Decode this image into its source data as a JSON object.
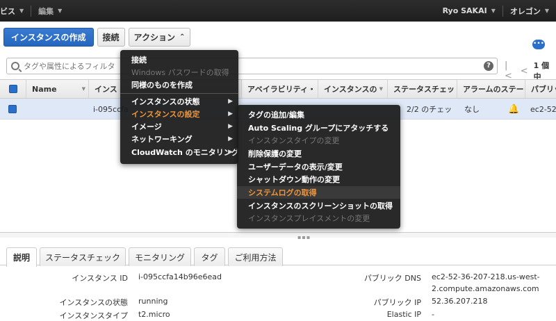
{
  "topnav": {
    "services": "ビス",
    "edit": "編集",
    "user": "Ryo SAKAI",
    "region": "オレゴン"
  },
  "toolbar": {
    "launch": "インスタンスの作成",
    "connect": "接続",
    "actions": "アクション"
  },
  "filter": {
    "placeholder": "タグや属性によるフィルタ",
    "help": "?",
    "count": "1 個中"
  },
  "table": {
    "headers": [
      "Name",
      "インス",
      "アベイラビリティ・",
      "インスタンスの",
      "ステータスチェッ",
      "アラームのステー",
      "パブリッ"
    ],
    "row": {
      "instance_id": "i-095ccfa",
      "status_check": "2/2 のチェッ",
      "alarm": "なし",
      "public_dns": "ec2-52-"
    }
  },
  "actions_menu": {
    "items": [
      {
        "label": "接続",
        "disabled": false
      },
      {
        "label": "Windows パスワードの取得",
        "disabled": true
      },
      {
        "label": "同様のものを作成",
        "disabled": false
      },
      {
        "label": "インスタンスの状態",
        "disabled": false,
        "submenu": true
      },
      {
        "label": "インスタンスの設定",
        "disabled": false,
        "submenu": true,
        "highlight": true
      },
      {
        "label": "イメージ",
        "disabled": false,
        "submenu": true
      },
      {
        "label": "ネットワーキング",
        "disabled": false,
        "submenu": true
      },
      {
        "label": "CloudWatch のモニタリング",
        "disabled": false,
        "submenu": true
      }
    ]
  },
  "settings_menu": {
    "items": [
      {
        "label": "タグの追加/編集",
        "disabled": false
      },
      {
        "label": "Auto Scaling グループにアタッチする",
        "disabled": false
      },
      {
        "label": "インスタンスタイプの変更",
        "disabled": true
      },
      {
        "label": "削除保護の変更",
        "disabled": false
      },
      {
        "label": "ユーザーデータの表示/変更",
        "disabled": false
      },
      {
        "label": "シャットダウン動作の変更",
        "disabled": false
      },
      {
        "label": "システムログの取得",
        "disabled": false,
        "highlight": true
      },
      {
        "label": "インスタンスのスクリーンショットの取得",
        "disabled": false
      },
      {
        "label": "インスタンスプレイスメントの変更",
        "disabled": true
      }
    ]
  },
  "tabs": [
    "説明",
    "ステータスチェック",
    "モニタリング",
    "タグ",
    "ご利用方法"
  ],
  "details": {
    "instance_id_label": "インスタンス ID",
    "instance_id": "i-095ccfa14b96e6ead",
    "state_label": "インスタンスの状態",
    "state": "running",
    "type_label": "インスタンスタイプ",
    "type": "t2.micro",
    "public_dns_label": "パブリック DNS",
    "public_dns_1": "ec2-52-36-207-218.us-west-",
    "public_dns_2": "2.compute.amazonaws.com",
    "public_ip_label": "パブリック IP",
    "public_ip": "52.36.207.218",
    "elastic_ip_label": "Elastic IP",
    "elastic_ip": "-"
  },
  "colors": {
    "accent": "#2a6fc9",
    "menu_highlight": "#f0963a"
  }
}
